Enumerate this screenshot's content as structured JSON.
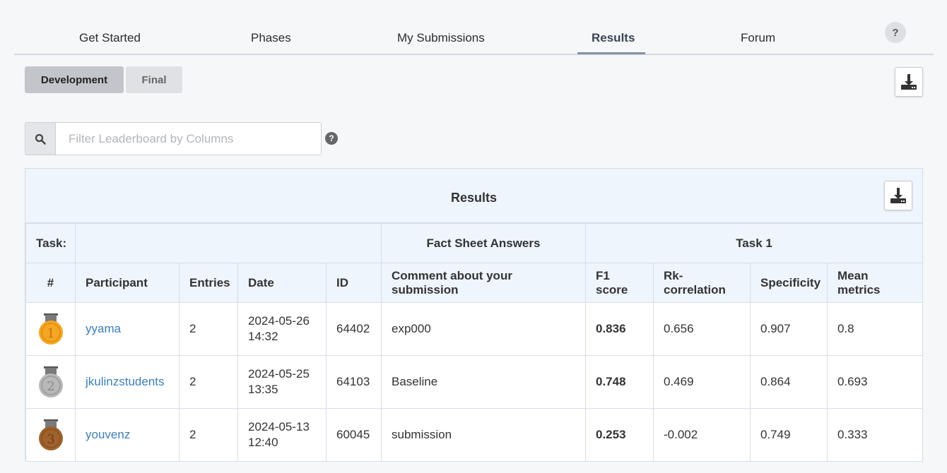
{
  "nav": {
    "tabs": [
      {
        "label": "Get Started"
      },
      {
        "label": "Phases"
      },
      {
        "label": "My Submissions"
      },
      {
        "label": "Results"
      },
      {
        "label": "Forum"
      }
    ],
    "help_label": "?"
  },
  "phases": {
    "development": "Development",
    "final": "Final"
  },
  "filter": {
    "placeholder": "Filter Leaderboard by Columns",
    "help_label": "?"
  },
  "results": {
    "title": "Results",
    "task_label": "Task:",
    "group_fact_sheet": "Fact Sheet Answers",
    "group_task1": "Task 1",
    "columns": [
      "#",
      "Participant",
      "Entries",
      "Date",
      "ID",
      "Comment about your submission",
      "F1 score",
      "Rk-correlation",
      "Specificity",
      "Mean metrics"
    ],
    "rows": [
      {
        "rank": "1",
        "participant": "yyama",
        "entries": "2",
        "date_line1": "2024-05-26",
        "date_line2": "14:32",
        "id": "64402",
        "comment": "exp000",
        "f1": "0.836",
        "rk": "0.656",
        "spec": "0.907",
        "mean": "0.8",
        "medal_color": "#f5a623"
      },
      {
        "rank": "2",
        "participant": "jkulinzstudents",
        "entries": "2",
        "date_line1": "2024-05-25",
        "date_line2": "13:35",
        "id": "64103",
        "comment": "Baseline",
        "f1": "0.748",
        "rk": "0.469",
        "spec": "0.864",
        "mean": "0.693",
        "medal_color": "#b8b8b8"
      },
      {
        "rank": "3",
        "participant": "youvenz",
        "entries": "2",
        "date_line1": "2024-05-13",
        "date_line2": "12:40",
        "id": "60045",
        "comment": "submission",
        "f1": "0.253",
        "rk": "-0.002",
        "spec": "0.749",
        "mean": "0.333",
        "medal_color": "#a0622d"
      }
    ]
  }
}
